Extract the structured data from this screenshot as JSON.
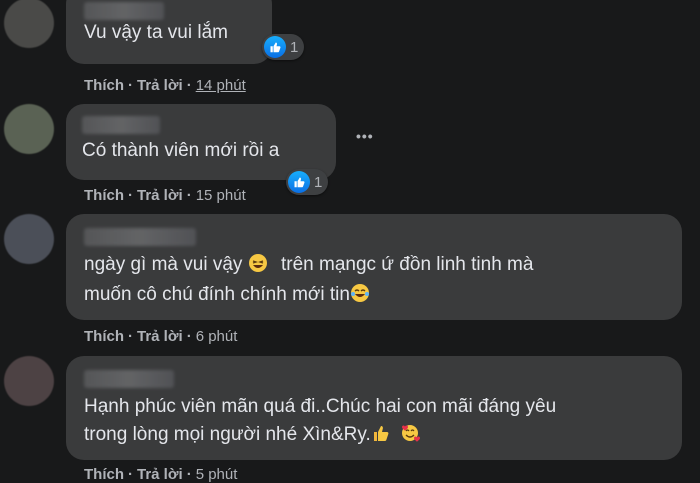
{
  "comments": [
    {
      "text": "Vu vậy ta vui lắm",
      "actions": {
        "like": "Thích",
        "reply": "Trả lời",
        "time": "14 phút"
      },
      "reaction_count": "1"
    },
    {
      "text": "Có thành viên mới rồi a",
      "actions": {
        "like": "Thích",
        "reply": "Trả lời",
        "time": "15 phút"
      },
      "reaction_count": "1",
      "more": "•••"
    },
    {
      "lines": [
        "ngày gì mà vui vậy",
        "trên mạngc ứ đồn linh tinh mà",
        "muốn cô chú đính chính mới tin"
      ],
      "actions": {
        "like": "Thích",
        "reply": "Trả lời",
        "time": "6 phút"
      }
    },
    {
      "lines": [
        "Hạnh phúc viên mãn quá đi..Chúc hai con mãi đáng yêu",
        "trong lòng mọi người nhé Xìn&Ry."
      ],
      "actions": {
        "like": "Thích",
        "reply": "Trả lời",
        "time": "5 phút"
      }
    }
  ],
  "icons": {
    "like": "like-icon",
    "laugh": "laughing-emoji-icon",
    "tears": "tears-of-joy-emoji-icon",
    "thumbs": "thumbs-up-emoji-icon",
    "love": "smiling-hearts-emoji-icon"
  }
}
